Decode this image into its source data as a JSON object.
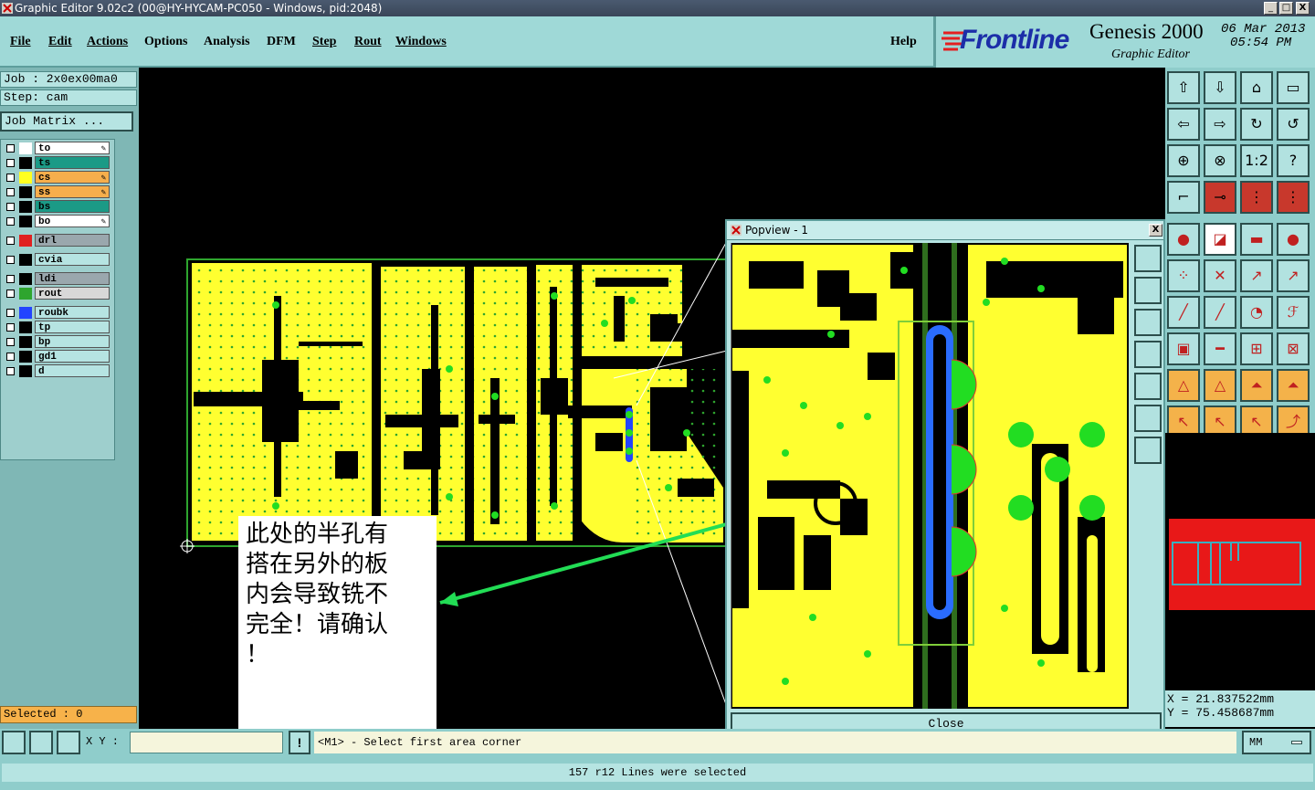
{
  "window": {
    "title": "Graphic Editor 9.02c2 (00@HY-HYCAM-PC050 - Windows, pid:2048)",
    "min": "_",
    "max": "□",
    "close": "X"
  },
  "menu": [
    "File",
    "Edit",
    "Actions",
    "Options",
    "Analysis",
    "DFM",
    "Step",
    "Rout",
    "Windows"
  ],
  "help": "Help",
  "brand": {
    "logo": "Frontline",
    "product": "Genesis 2000",
    "subtitle": "Graphic Editor",
    "date": "06 Mar 2013",
    "time": "05:54 PM"
  },
  "job": {
    "job_label": "Job : 2x0ex00ma0",
    "step_label": "Step: cam",
    "matrix_button": "Job Matrix ..."
  },
  "layers": [
    {
      "name": "to",
      "color": "#ffffff",
      "name_bg": "#ffffff",
      "edit": true
    },
    {
      "name": "ts",
      "color": "#000000",
      "name_bg": "#1b9a86",
      "edit": false
    },
    {
      "name": "cs",
      "color": "#ffff20",
      "name_bg": "#f6ae4c",
      "edit": true
    },
    {
      "name": "ss",
      "color": "#000000",
      "name_bg": "#f6ae4c",
      "edit": true
    },
    {
      "name": "bs",
      "color": "#000000",
      "name_bg": "#1b9a86",
      "edit": false
    },
    {
      "name": "bo",
      "color": "#000000",
      "name_bg": "#ffffff",
      "edit": true
    },
    {
      "name": "drl",
      "color": "#e02020",
      "name_bg": "#9aa7ad",
      "edit": false
    },
    {
      "name": "cvia",
      "color": "#000000",
      "name_bg": "#b6e4e2",
      "edit": false
    },
    {
      "name": "ldi",
      "color": "#000000",
      "name_bg": "#9aa7ad",
      "edit": false
    },
    {
      "name": "rout",
      "color": "#2ea52e",
      "name_bg": "#d8d8d8",
      "edit": false
    },
    {
      "name": "roubk",
      "color": "#2244ff",
      "name_bg": "#b6e4e2",
      "edit": false
    },
    {
      "name": "tp",
      "color": "#000000",
      "name_bg": "#b6e4e2",
      "edit": false
    },
    {
      "name": "bp",
      "color": "#000000",
      "name_bg": "#b6e4e2",
      "edit": false
    },
    {
      "name": "gd1",
      "color": "#000000",
      "name_bg": "#b6e4e2",
      "edit": false
    },
    {
      "name": "d",
      "color": "#000000",
      "name_bg": "#b6e4e2",
      "edit": false
    }
  ],
  "selected": "Selected : 0",
  "popview": {
    "title": "Popview - 1",
    "close_label": "Close"
  },
  "annotation": "此处的半孔有\n搭在另外的板\n内会导致铣不\n完全！请确认\n！",
  "coords": {
    "x": "X = 21.837522mm",
    "y": "Y = 75.458687mm"
  },
  "cmd": {
    "xy_label": "X Y :",
    "xy_value": "",
    "prompt": "<M1> - Select first area corner",
    "units": "MM"
  },
  "status": "157 r12 Lines were selected",
  "toolbar_glyphs": [
    "⇧",
    "⇩",
    "⌂",
    "▭",
    "⇦",
    "⇨",
    "↻",
    "↺",
    "⊕",
    "⊗",
    "1:2",
    "?",
    "⌐",
    "⊸",
    "⋮",
    "⋮",
    "●",
    "◪",
    "▬",
    "●",
    "⁘",
    "✕",
    "↗",
    "↗",
    "╱",
    "╱",
    "◔",
    "ℱ",
    "▣",
    "━",
    "⊞",
    "⊠",
    "△",
    "△",
    "⏶",
    "⏶",
    "↖",
    "↖",
    "↖",
    "⤴"
  ]
}
